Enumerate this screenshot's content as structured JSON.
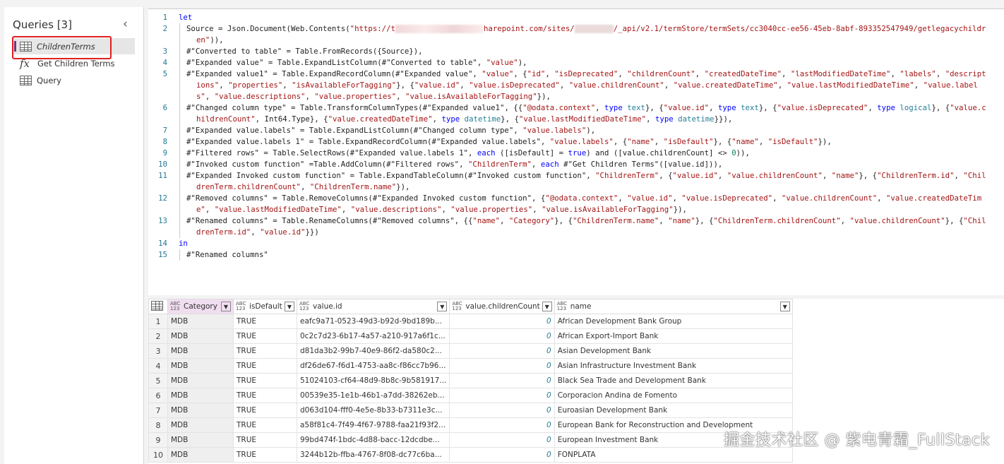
{
  "queries_panel": {
    "title": "Queries [3]",
    "collapse_icon": "chevron-left-icon",
    "items": [
      {
        "label": "ChildrenTerms",
        "icon": "table-icon"
      },
      {
        "label": "Get Children Terms",
        "icon": "fx-icon"
      },
      {
        "label": "Query",
        "icon": "table-icon"
      }
    ]
  },
  "editor": {
    "lines": [
      "let",
      [
        [
          "p",
          "Source = Json.Document(Web.Contents("
        ],
        [
          "s",
          "\"https://t"
        ],
        [
          "b1",
          ""
        ],
        [
          "s",
          "harepoint.com/sites/"
        ],
        [
          "b2",
          ""
        ],
        [
          "s",
          "/_api/v2.1/termStore/termSets/cc3040cc-ee56-45eb-8abf-893352547949/getlegacychildren\""
        ],
        [
          "p",
          ")),"
        ]
      ],
      "#\"Converted to table\" = Table.FromRecords({Source}),",
      "#\"Expanded value\" = Table.ExpandListColumn(#\"Converted to table\", \"value\"),",
      "#\"Expanded value1\" = Table.ExpandRecordColumn(#\"Expanded value\", \"value\", {\"id\", \"isDeprecated\", \"childrenCount\", \"createdDateTime\", \"lastModifiedDateTime\", \"labels\", \"descriptions\", \"properties\", \"isAvailableForTagging\"}, {\"value.id\", \"value.isDeprecated\", \"value.childrenCount\", \"value.createdDateTime\", \"value.lastModifiedDateTime\", \"value.labels\", \"value.descriptions\", \"value.properties\", \"value.isAvailableForTagging\"}),",
      "#\"Changed column type\" = Table.TransformColumnTypes(#\"Expanded value1\", {{\"@odata.context\", type text}, {\"value.id\", type text}, {\"value.isDeprecated\", type logical}, {\"value.childrenCount\", Int64.Type}, {\"value.createdDateTime\", type datetime}, {\"value.lastModifiedDateTime\", type datetime}}),",
      "#\"Expanded value.labels\" = Table.ExpandListColumn(#\"Changed column type\", \"value.labels\"),",
      "#\"Expanded value.labels 1\" = Table.ExpandRecordColumn(#\"Expanded value.labels\", \"value.labels\", {\"name\", \"isDefault\"}, {\"name\", \"isDefault\"}),",
      "#\"Filtered rows\" = Table.SelectRows(#\"Expanded value.labels 1\", each ([isDefault] = true) and ([value.childrenCount] <> 0)),",
      "#\"Invoked custom function\" =Table.AddColumn(#\"Filtered rows\", \"ChildrenTerm\", each #\"Get Children Terms\"([value.id])),",
      "#\"Expanded Invoked custom function\" = Table.ExpandTableColumn(#\"Invoked custom function\", \"ChildrenTerm\", {\"value.id\", \"value.childrenCount\", \"name\"}, {\"ChildrenTerm.id\", \"ChildrenTerm.childrenCount\", \"ChildrenTerm.name\"}),",
      "#\"Removed columns\" = Table.RemoveColumns(#\"Expanded Invoked custom function\", {\"@odata.context\", \"value.id\", \"value.isDeprecated\", \"value.childrenCount\", \"value.createdDateTime\", \"value.lastModifiedDateTime\", \"value.descriptions\", \"value.properties\", \"value.isAvailableForTagging\"}),",
      "#\"Renamed columns\" = Table.RenameColumns(#\"Removed columns\", {{\"name\", \"Category\"}, {\"ChildrenTerm.name\", \"name\"}, {\"ChildrenTerm.childrenCount\", \"value.childrenCount\"}, {\"ChildrenTerm.id\", \"value.id\"}})",
      "in",
      "#\"Renamed columns\""
    ]
  },
  "grid": {
    "type_badge": "ABC 123",
    "columns": [
      "Category",
      "isDefault",
      "value.id",
      "value.childrenCount",
      "name"
    ],
    "rows": [
      [
        "1",
        "MDB",
        "TRUE",
        "eafc9a71-0523-49d3-b92d-9bd189b...",
        "0",
        "African Development Bank Group"
      ],
      [
        "2",
        "MDB",
        "TRUE",
        "0c2c7d23-6b17-4a57-a210-917a6f1c...",
        "0",
        "African Export-Import Bank"
      ],
      [
        "3",
        "MDB",
        "TRUE",
        "d81da3b2-99b7-40e9-86f2-da580c2...",
        "0",
        "Asian Development Bank"
      ],
      [
        "4",
        "MDB",
        "TRUE",
        "df26de67-f6d1-4753-aa8c-f86cc7b96...",
        "0",
        "Asian Infrastructure Investment Bank"
      ],
      [
        "5",
        "MDB",
        "TRUE",
        "51024103-cf64-48d9-8b8c-9b581917...",
        "0",
        "Black Sea Trade and Development Bank"
      ],
      [
        "6",
        "MDB",
        "TRUE",
        "00539e35-1e1b-46b1-a7dd-38262eb...",
        "0",
        "Corporacion Andina de Fomento"
      ],
      [
        "7",
        "MDB",
        "TRUE",
        "d063d104-fff0-4e5e-8b33-b7311e3c...",
        "0",
        "Euroasian Development Bank"
      ],
      [
        "8",
        "MDB",
        "TRUE",
        "a58f81c4-7f49-4f67-9788-faa21f93f2...",
        "0",
        "European Bank for Reconstruction and Development"
      ],
      [
        "9",
        "MDB",
        "TRUE",
        "99bd474f-1bdc-4d88-bacc-12dcdbe...",
        "0",
        "European Investment Bank"
      ],
      [
        "10",
        "MDB",
        "TRUE",
        "3244b12b-ffba-4767-8f08-dc77c6ba...",
        "0",
        "FONPLATA"
      ]
    ]
  },
  "watermark": "掘金技术社区 @ 紫电青霜_FullStack",
  "colors": {
    "keyword": "#0000ff",
    "string": "#a31515",
    "type": "#267f99",
    "selected_marker": "#7b2f7d",
    "highlight_box": "#e02020"
  }
}
